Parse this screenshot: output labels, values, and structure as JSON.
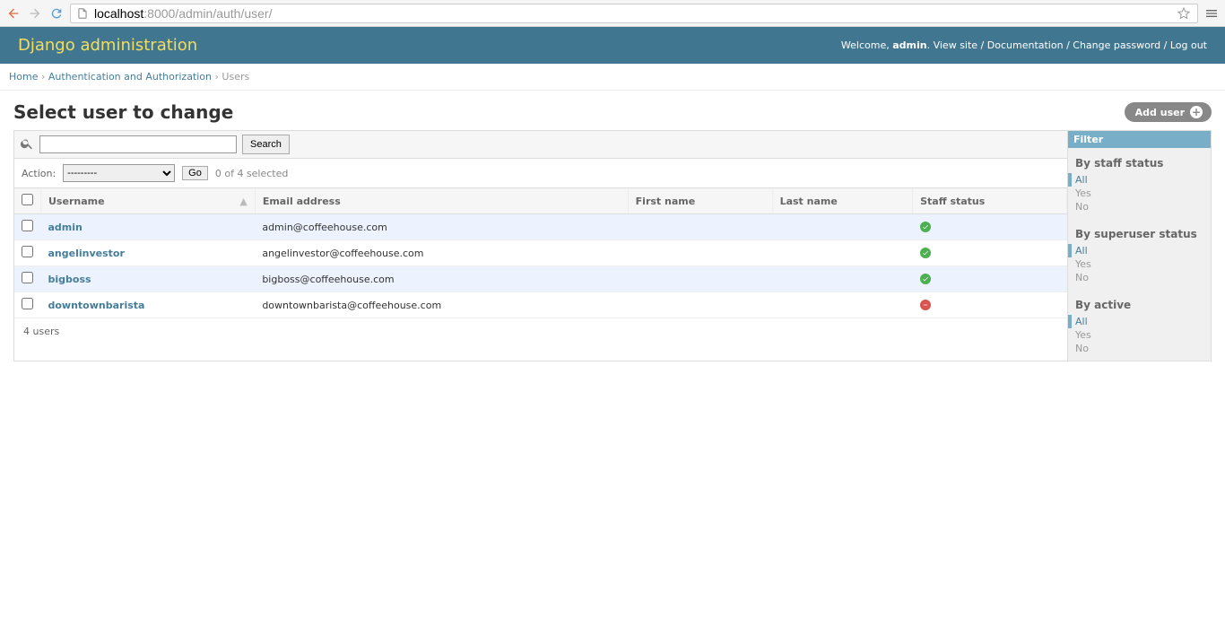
{
  "browser": {
    "url_pre": "localhost",
    "url_post": ":8000/admin/auth/user/"
  },
  "header": {
    "branding": "Django administration",
    "welcome": "Welcome, ",
    "username": "admin",
    "view_site": "View site",
    "documentation": "Documentation",
    "change_password": "Change password",
    "logout": "Log out"
  },
  "breadcrumbs": {
    "home": "Home",
    "auth": "Authentication and Authorization",
    "current": "Users"
  },
  "page": {
    "title": "Select user to change",
    "add_button": "Add user"
  },
  "toolbar": {
    "search_button": "Search"
  },
  "actions": {
    "label": "Action:",
    "default_option": "---------",
    "go": "Go",
    "selection": "0 of 4 selected"
  },
  "columns": {
    "username": "Username",
    "email": "Email address",
    "first_name": "First name",
    "last_name": "Last name",
    "staff": "Staff status"
  },
  "rows": [
    {
      "username": "admin",
      "email": "admin@coffeehouse.com",
      "first_name": "",
      "last_name": "",
      "staff": true
    },
    {
      "username": "angelinvestor",
      "email": "angelinvestor@coffeehouse.com",
      "first_name": "",
      "last_name": "",
      "staff": true
    },
    {
      "username": "bigboss",
      "email": "bigboss@coffeehouse.com",
      "first_name": "",
      "last_name": "",
      "staff": true
    },
    {
      "username": "downtownbarista",
      "email": "downtownbarista@coffeehouse.com",
      "first_name": "",
      "last_name": "",
      "staff": false
    }
  ],
  "paginator": "4 users",
  "filters": {
    "title": "Filter",
    "groups": [
      {
        "heading": "By staff status",
        "items": [
          {
            "label": "All",
            "selected": true
          },
          {
            "label": "Yes",
            "selected": false
          },
          {
            "label": "No",
            "selected": false
          }
        ]
      },
      {
        "heading": "By superuser status",
        "items": [
          {
            "label": "All",
            "selected": true
          },
          {
            "label": "Yes",
            "selected": false
          },
          {
            "label": "No",
            "selected": false
          }
        ]
      },
      {
        "heading": "By active",
        "items": [
          {
            "label": "All",
            "selected": true
          },
          {
            "label": "Yes",
            "selected": false
          },
          {
            "label": "No",
            "selected": false
          }
        ]
      }
    ]
  }
}
